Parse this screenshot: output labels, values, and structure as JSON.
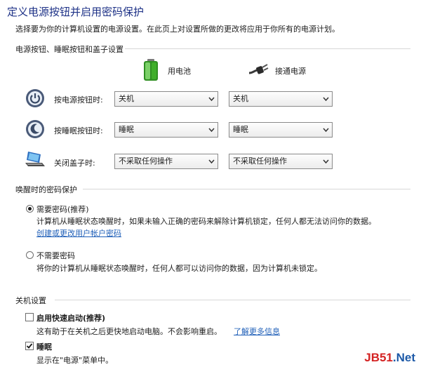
{
  "header": {
    "title": "定义电源按钮并启用密码保护",
    "description": "选择要为你的计算机设置的电源设置。在此页上对设置所做的更改将应用于你所有的电源计划。"
  },
  "buttons_section": {
    "heading": "电源按钮、睡眠按钮和盖子设置",
    "column_battery": "用电池",
    "column_plugged": "接通电源",
    "rows": [
      {
        "label": "按电源按钮时:",
        "battery": "关机",
        "plugged": "关机"
      },
      {
        "label": "按睡眠按钮时:",
        "battery": "睡眠",
        "plugged": "睡眠"
      },
      {
        "label": "关闭盖子时:",
        "battery": "不采取任何操作",
        "plugged": "不采取任何操作"
      }
    ]
  },
  "password_section": {
    "heading": "唤醒时的密码保护",
    "require": {
      "label": "需要密码(推荐)",
      "selected": true,
      "description": "计算机从睡眠状态唤醒时，如果未输入正确的密码来解除计算机锁定，任何人都无法访问你的数据。",
      "link": "创建或更改用户帐户密码"
    },
    "no_require": {
      "label": "不需要密码",
      "selected": false,
      "description": "将你的计算机从睡眠状态唤醒时，任何人都可以访问你的数据，因为计算机未锁定。"
    }
  },
  "shutdown_section": {
    "heading": "关机设置",
    "fast_startup": {
      "label": "启用快速启动(推荐)",
      "checked": false,
      "description": "这有助于在关机之后更快地启动电脑。不会影响重启。",
      "link": "了解更多信息"
    },
    "sleep": {
      "label": "睡眠",
      "checked": true,
      "description": "显示在\"电源\"菜单中。"
    }
  },
  "watermark": {
    "brand": "JB51",
    "suffix": ".Net"
  },
  "colors": {
    "title": "#1e3287",
    "link": "#1f5fb8",
    "battery_green": "#3fae2a"
  }
}
